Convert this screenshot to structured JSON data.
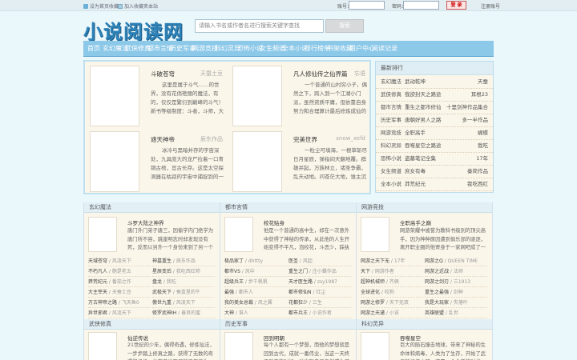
{
  "topbar": {
    "home_link": "设为首页收藏",
    "fav_link": "加入收藏夹本站",
    "username_label": "账号：",
    "password_label": "密码：",
    "login_button": "登 录",
    "register_link": "注册账号"
  },
  "header": {
    "logo": "小说阅读网",
    "search_placeholder": "请输入书名或作者名进行搜索关键字查找",
    "search_button": "搜索"
  },
  "nav": [
    "首页",
    "玄幻魔法",
    "武侠修真",
    "都市言情",
    "历史军事",
    "网游竞技",
    "科幻灵异",
    "恐怖小说",
    "女生频道",
    "全本小说",
    "排行榜单",
    "书架收藏",
    "用户中心",
    "阅读记录"
  ],
  "featured": [
    {
      "title": "斗破苍穹",
      "author": "天蚕土豆",
      "desc": "这里是属于斗气……的世界，没有花俏艳丽的魔法，有的，仅仅是繁衍到巅峰的斗气！新书等级制度：斗者，斗师，大斗师 ..."
    },
    {
      "title": "凡人修仙传之仙界篇",
      "author": "忘语",
      "desc": "一个普通的山村穷小子，偶然之下，跨入到一个江湖小门派，虽然资质平庸，但依靠自身努力和合理算计最后修炼成仙的故事。"
    },
    {
      "title": "遮天神帝",
      "author": "辰东作品",
      "desc": "冰冷与黑暗并存的宇宙深处，九具庞大的龙尸拉着一口青铜古棺，亘古长存。这是太空探测器在枯寂的宇宙中捕捉到的一幅 ..."
    },
    {
      "title": "完美世界",
      "author": "snow_xefd",
      "desc": "一粒尘可填海，一根草斩尽日月星辰，弹指间天翻地覆。群雄并起，万族林立，诸圣争霸，乱天动地。问苍茫大地，谁主沉浮？"
    }
  ],
  "rank": {
    "title": "最新排行",
    "rows": [
      {
        "cat": "玄幻魔法",
        "name": "武动乾坤",
        "val": "天蚕"
      },
      {
        "cat": "武侠修真",
        "name": "我欲封天之路途",
        "val": "耳根23"
      },
      {
        "cat": "都市言情",
        "name": "重生之都市修仙",
        "val": "十里剑神作品集合"
      },
      {
        "cat": "历史军事",
        "name": "唐朝好男人之路",
        "val": "多一半作品"
      },
      {
        "cat": "网游竞技",
        "name": "全职高手",
        "val": "蝴蝶"
      },
      {
        "cat": "科幻灵异",
        "name": "吞噬星空之路途",
        "val": "我吃"
      },
      {
        "cat": "恐怖小说",
        "name": "盗墓笔记全集",
        "val": "17年"
      },
      {
        "cat": "女生频道",
        "name": "庶女有毒",
        "val": "秦简作品"
      },
      {
        "cat": "全本小说",
        "name": "莽荒纪元",
        "val": "我吃西红"
      }
    ]
  },
  "columns": [
    {
      "head": "玄幻魔法",
      "top_title": "斗罗大陆之神界",
      "top_desc": "唐门外门弟子唐三，因偷学内门绝学为唐门所不容，跳崖明志时却发现没有死，反而以另外一个身份来到了另一个世界，一个属于武魂的世界 (l",
      "list": [
        {
          "t": "天域苍穹",
          "a": "风凌天下"
        },
        {
          "t": "神墓重生",
          "a": "辰东作品"
        },
        {
          "t": "不朽凡人",
          "a": "鹅是老五"
        },
        {
          "t": "星辰变后",
          "a": "我吃西红柿"
        },
        {
          "t": "莽荒纪元",
          "a": "番茄之作"
        },
        {
          "t": "盘龙",
          "a": "我吃"
        },
        {
          "t": "大主宰天",
          "a": "天蚕土豆"
        },
        {
          "t": "武极天下",
          "a": "蚕茧里的牛"
        },
        {
          "t": "万古神帝之路",
          "a": "飞天鱼0"
        },
        {
          "t": "傲世九重",
          "a": "风凌天下"
        },
        {
          "t": "异世邪君",
          "a": "风凌天下"
        },
        {
          "t": "修罗武神IH",
          "a": "善良的蜜"
        }
      ],
      "bottom_head": "武侠修真",
      "bottom_title": "仙逆传说",
      "bottom_desc": "21世纪的少年，偶得奇遇，修炼仙法，一步步踏上修真之路，获得了无数的奇遇和机缘，也有着说不尽的恩怨情仇，最终成 ..."
    },
    {
      "head": "都市言情",
      "top_title": "校花贴身",
      "top_desc": "他是一个普通的高中生，却在一次意外中获得了神秘的传承，从此他的人生开始变得不平凡，泡校花，斗恶少，踩纨绔 ...",
      "list": [
        {
          "t": "极品家丁",
          "a": "dhttty"
        },
        {
          "t": "医圣",
          "a": "风起"
        },
        {
          "t": "都市VS",
          "a": "风中"
        },
        {
          "t": "重生之门",
          "a": "庄小蝶作品"
        },
        {
          "t": "超级兵王",
          "a": "步千帆帆"
        },
        {
          "t": "天才医生路",
          "a": "zsy1987"
        },
        {
          "t": "最强",
          "a": "都市人"
        },
        {
          "t": "都市修仙N",
          "a": "红尘"
        },
        {
          "t": "我的美女总裁",
          "a": "风之翼"
        },
        {
          "t": "花都狂少",
          "a": "三生"
        },
        {
          "t": "大神",
          "a": "谁人"
        },
        {
          "t": "都市兵王",
          "a": "小说作者"
        }
      ],
      "bottom_head": "历史军事",
      "bottom_title": "回到明朝",
      "bottom_desc": "每个人都有一个梦想，而他的梦想就是回到古代，成就一番伟业，当这一天终于到来的时候，他发现自己竟然成为了一个 ..."
    },
    {
      "head": "网游竞技",
      "top_title": "全职高手之巅",
      "top_desc": "网游荣耀中被誉为教科书级别的顶尖高手，因为种种原因遭到俱乐部的驱逐，离开职业圈的他寄身于一家网吧成了一个小小的网管……",
      "list": [
        {
          "t": "网游之天下无",
          "a": "17年"
        },
        {
          "t": "网游之Q",
          "a": "QUEEN TIME"
        },
        {
          "t": "天下",
          "a": "网游作者"
        },
        {
          "t": "网游之近战",
          "a": "法师"
        },
        {
          "t": "超神机械师",
          "a": "齐佩"
        },
        {
          "t": "网游之剑刃",
          "a": "三1913"
        },
        {
          "t": "全球进化",
          "a": "咬狗"
        },
        {
          "t": "重生之最强",
          "a": "剑神"
        },
        {
          "t": "网游之修罗",
          "a": "天下无双"
        },
        {
          "t": "我是大玩家",
          "a": "失落叶"
        },
        {
          "t": "网游之天谴",
          "a": "小说"
        },
        {
          "t": "英雄联盟",
          "a": "乱世"
        }
      ],
      "bottom_head": "科幻灵异",
      "bottom_title": "吞噬星空",
      "bottom_desc": "巨大的陨石撞击地球，带来了神秘的生命体和病毒，人类为了生存，开始了武者的修炼之路，这是一个全新的时代，一个 ..."
    }
  ]
}
